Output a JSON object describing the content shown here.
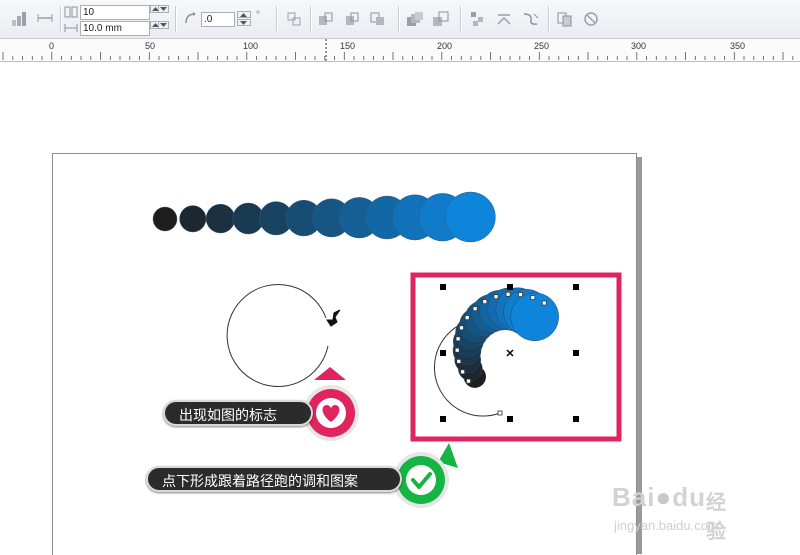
{
  "toolbar": {
    "steps_value": "10",
    "spacing_value": "10.0 mm",
    "rotation_value": ".0",
    "rotation_unit": "°"
  },
  "ruler": {
    "labels": [
      "0",
      "50",
      "100",
      "150",
      "200",
      "250",
      "300",
      "350"
    ]
  },
  "blend_colors": {
    "start": "#1e1e1e",
    "end": "#0e84db"
  },
  "callouts": {
    "first": "出现如图的标志",
    "second": "点下形成跟着路径跑的调和图案"
  },
  "badge_colors": {
    "first": "#e0245e",
    "second": "#16b445"
  },
  "highlight_color": "#e0245e",
  "watermark": {
    "logo": "Bai",
    "logo_tail": "du",
    "cn": "经验",
    "url": "jingyan.baidu.com"
  }
}
